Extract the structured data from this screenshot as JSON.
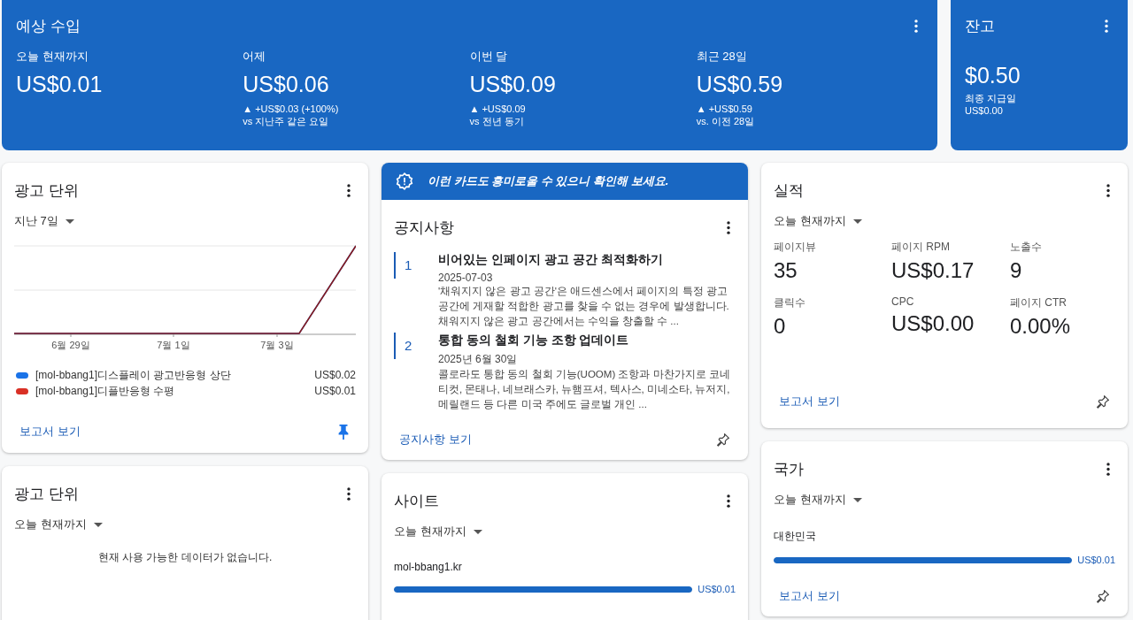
{
  "revenue": {
    "title": "예상 수입",
    "stats": [
      {
        "label": "오늘 현재까지",
        "value": "US$0.01"
      },
      {
        "label": "어제",
        "value": "US$0.06",
        "change": "▲ +US$0.03 (+100%)",
        "compare": "vs 지난주 같은 요일"
      },
      {
        "label": "이번 달",
        "value": "US$0.09",
        "change": "▲ +US$0.09",
        "compare": "vs 전년 동기"
      },
      {
        "label": "최근 28일",
        "value": "US$0.59",
        "change": "▲ +US$0.59",
        "compare": "vs. 이전 28일"
      }
    ]
  },
  "balance": {
    "title": "잔고",
    "value": "$0.50",
    "sub_label": "최종 지급일",
    "sub_value": "US$0.00"
  },
  "ad_units_chart": {
    "title": "광고 단위",
    "period": "지난 7일",
    "x_labels": [
      "6월 29일",
      "7월 1일",
      "7월 3일"
    ],
    "legend": [
      {
        "name": "[mol-bbang1]디스플레이 광고반응형 상단",
        "value": "US$0.02",
        "color": "#1a73e8"
      },
      {
        "name": "[mol-bbang1]디플반응형 수평",
        "value": "US$0.01",
        "color": "#d93025"
      }
    ],
    "link": "보고서 보기",
    "pinned": true
  },
  "ad_units_today": {
    "title": "광고 단위",
    "period": "오늘 현재까지",
    "empty_message": "현재 사용 가능한 데이터가 없습니다."
  },
  "suggestion_banner": "이런 카드도 흥미로울 수 있으니 확인해 보세요.",
  "notices": {
    "title": "공지사항",
    "items": [
      {
        "number": "1",
        "title": "비어있는 인페이지 광고 공간 최적화하기",
        "date": "2025-07-03",
        "body": "'채워지지 않은 광고 공간'은 애드센스에서 페이지의 특정 광고 공간에 게재할 적합한 광고를 찾을 수 없는 경우에 발생합니다. 채워지지 않은 광고 공간에서는 수익을 창출할 수 ..."
      },
      {
        "number": "2",
        "title": "통합 동의 철회 기능 조항 업데이트",
        "date": "2025년 6월 30일",
        "body": "콜로라도 통합 동의 철회 기능(UOOM) 조항과 마찬가지로 코네티컷, 몬태나, 네브래스카, 뉴햄프셔, 텍사스, 미네소타, 뉴저지, 메릴랜드 등 다른 미국 주에도 글로벌 개인 ..."
      }
    ],
    "link": "공지사항 보기",
    "pinned": false
  },
  "sites": {
    "title": "사이트",
    "period": "오늘 현재까지",
    "rows": [
      {
        "name": "mol-bbang1.kr",
        "level": 1,
        "value": "US$0.01"
      }
    ]
  },
  "performance": {
    "title": "실적",
    "period": "오늘 현재까지",
    "metrics": [
      {
        "label": "페이지뷰",
        "value": "35"
      },
      {
        "label": "페이지 RPM",
        "value": "US$0.17"
      },
      {
        "label": "노출수",
        "value": "9"
      },
      {
        "label": "클릭수",
        "value": "0"
      },
      {
        "label": "CPC",
        "value": "US$0.00"
      },
      {
        "label": "페이지 CTR",
        "value": "0.00%"
      }
    ],
    "link": "보고서 보기",
    "pinned": false
  },
  "countries": {
    "title": "국가",
    "period": "오늘 현재까지",
    "rows": [
      {
        "name": "대한민국",
        "level": 1,
        "value": "US$0.01"
      }
    ],
    "link": "보고서 보기",
    "pinned": false
  }
}
